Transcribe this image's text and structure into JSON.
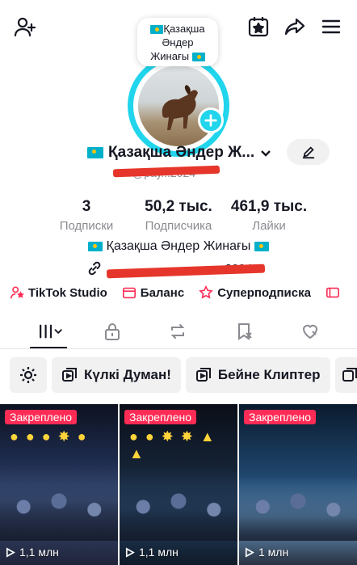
{
  "top_bar": {
    "icons": [
      "add-friend-icon",
      "calendar-star-icon",
      "share-icon",
      "menu-icon"
    ]
  },
  "note": {
    "line1": "Қазақша",
    "line2": "Әндер",
    "line3": "Жинағы"
  },
  "profile": {
    "name": "Қазақша Әндер Ж...",
    "handle": "@рау...2024",
    "bio": "Қазақша Әндер Жинағы",
    "link": "2024"
  },
  "stats": [
    {
      "value": "3",
      "label": "Подписки"
    },
    {
      "value": "50,2 тыс.",
      "label": "Подписчика"
    },
    {
      "value": "461,9 тыс.",
      "label": "Лайки"
    }
  ],
  "features": [
    {
      "label": "TikTok Studio",
      "icon": "tiktok-studio-icon"
    },
    {
      "label": "Баланс",
      "icon": "wallet-icon"
    },
    {
      "label": "Суперподписка",
      "icon": "superfollow-icon"
    }
  ],
  "tabs": [
    "grid-icon",
    "lock-icon",
    "repost-icon",
    "favorites-icon",
    "liked-icon"
  ],
  "playlists": [
    {
      "label": "Күлкі Думан!"
    },
    {
      "label": "Бейне Клиптер"
    }
  ],
  "videos": [
    {
      "pinned": "Закреплено",
      "views": "1,1 млн"
    },
    {
      "pinned": "Закреплено",
      "views": "1,1 млн"
    },
    {
      "pinned": "Закреплено",
      "views": "1 млн"
    }
  ],
  "colors": {
    "accent": "#20d5ec",
    "pin": "#fe2c55",
    "text": "#161823",
    "muted": "#8a8b91"
  }
}
